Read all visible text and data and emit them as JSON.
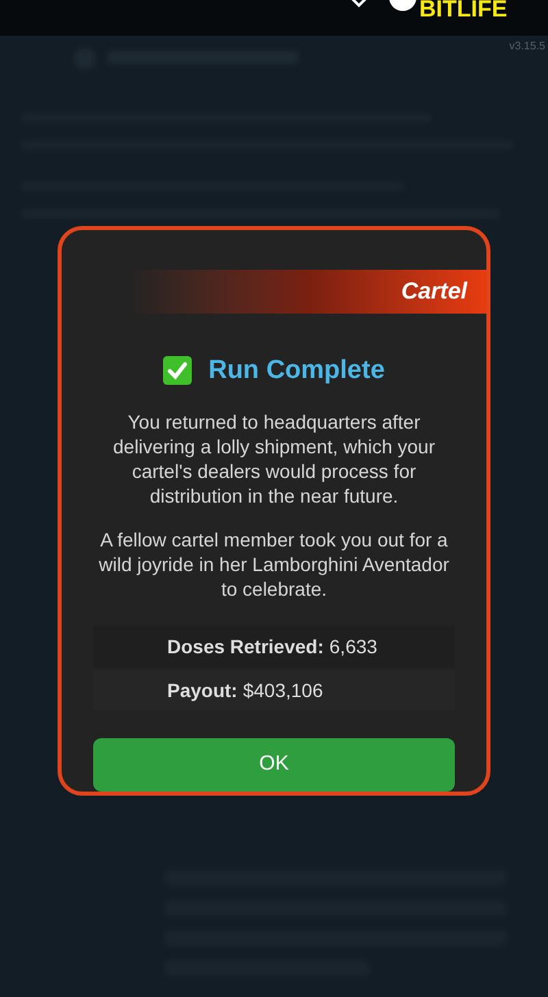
{
  "app_logo": "BITLIFE",
  "version": "v3.15.5",
  "dialog": {
    "category": "Cartel",
    "title": "Run Complete",
    "checked": true,
    "paragraphs": [
      "You returned to headquarters after delivering a lolly shipment, which your cartel's dealers would process for distribution in the near future.",
      "A fellow cartel member took you out for a wild joyride in her Lamborghini Aventador to celebrate."
    ],
    "stats": [
      {
        "label": "Doses Retrieved:",
        "value": "6,633"
      },
      {
        "label": "Payout:",
        "value": "$403,106"
      }
    ],
    "button": "OK"
  }
}
